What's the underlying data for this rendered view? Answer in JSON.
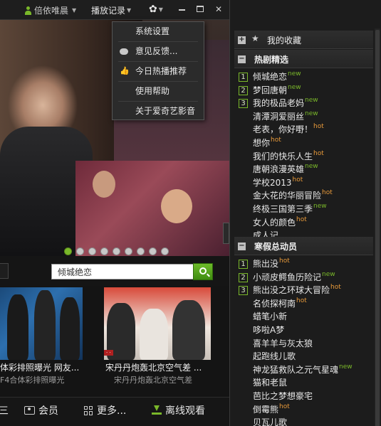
{
  "titlebar": {
    "username": "倍依唯晨",
    "history_label": "播放记录"
  },
  "settings_menu": {
    "items": [
      {
        "label": "系统设置",
        "icon": null
      },
      {
        "label": "意见反馈...",
        "icon": "speech-bubble-icon"
      },
      {
        "label": "今日热播推荐",
        "icon": "thumbs-up-icon"
      },
      {
        "label": "使用帮助",
        "icon": null
      },
      {
        "label": "关于爱奇艺影音",
        "icon": null
      }
    ]
  },
  "carousel": {
    "slide_count": 9,
    "active_index": 0
  },
  "search": {
    "value": "倾城绝恋"
  },
  "videos": [
    {
      "title": "体彩排照曝光 网友...",
      "subtitle": "F4合体彩排照曝光"
    },
    {
      "title": "宋丹丹炮轰北京空气差 ...",
      "subtitle": "宋丹丹炮轰北京空气差"
    }
  ],
  "toolbar": {
    "member_label": "会员",
    "more_label": "更多...",
    "offline_label": "离线观看"
  },
  "sidebar": {
    "favorites_label": "我的收藏",
    "sections": [
      {
        "title": "热剧精选",
        "items": [
          {
            "rank": "1",
            "label": "倾城绝恋",
            "tag": "new"
          },
          {
            "rank": "2",
            "label": "梦回唐朝",
            "tag": "new"
          },
          {
            "rank": "3",
            "label": "我的极品老妈",
            "tag": "new"
          },
          {
            "rank": "",
            "label": "清潭洞爱丽丝",
            "tag": "new"
          },
          {
            "rank": "",
            "label": "老表，你好嘢！",
            "tag": "hot"
          },
          {
            "rank": "",
            "label": "想你",
            "tag": "hot"
          },
          {
            "rank": "",
            "label": "我们的快乐人生",
            "tag": "hot"
          },
          {
            "rank": "",
            "label": "唐朝浪漫英雄",
            "tag": "new"
          },
          {
            "rank": "",
            "label": "学校2013",
            "tag": "hot"
          },
          {
            "rank": "",
            "label": "金大花的华丽冒险",
            "tag": "hot"
          },
          {
            "rank": "",
            "label": "终极三国第三季",
            "tag": "new"
          },
          {
            "rank": "",
            "label": "女人的颜色",
            "tag": "hot"
          },
          {
            "rank": "",
            "label": "成人记",
            "tag": ""
          }
        ]
      },
      {
        "title": "寒假总动员",
        "items": [
          {
            "rank": "",
            "label": "熊出没",
            "tag": "hot"
          },
          {
            "rank": "1",
            "label": "熊出没",
            "tag": "hot"
          },
          {
            "rank": "2",
            "label": "小顽皮鳄鱼历险记",
            "tag": "new"
          },
          {
            "rank": "3",
            "label": "熊出没之环球大冒险",
            "tag": "hot"
          },
          {
            "rank": "",
            "label": "名侦探柯南",
            "tag": "hot"
          },
          {
            "rank": "",
            "label": "蜡笔小新",
            "tag": ""
          },
          {
            "rank": "",
            "label": "哆啦A梦",
            "tag": ""
          },
          {
            "rank": "",
            "label": "喜羊羊与灰太狼",
            "tag": ""
          },
          {
            "rank": "",
            "label": "起跑线儿歌",
            "tag": ""
          },
          {
            "rank": "",
            "label": "神龙猛救队之元气星魂",
            "tag": "new"
          },
          {
            "rank": "",
            "label": "猫和老鼠",
            "tag": ""
          },
          {
            "rank": "",
            "label": "芭比之梦想豪宅",
            "tag": ""
          },
          {
            "rank": "",
            "label": "倒霉熊",
            "tag": "hot"
          },
          {
            "rank": "",
            "label": "贝瓦儿歌",
            "tag": ""
          }
        ]
      }
    ]
  },
  "colors": {
    "accent": "#7ab82a",
    "new_tag": "#7ab82a",
    "hot_tag": "#e89a3a",
    "background": "#1b1b1b"
  }
}
